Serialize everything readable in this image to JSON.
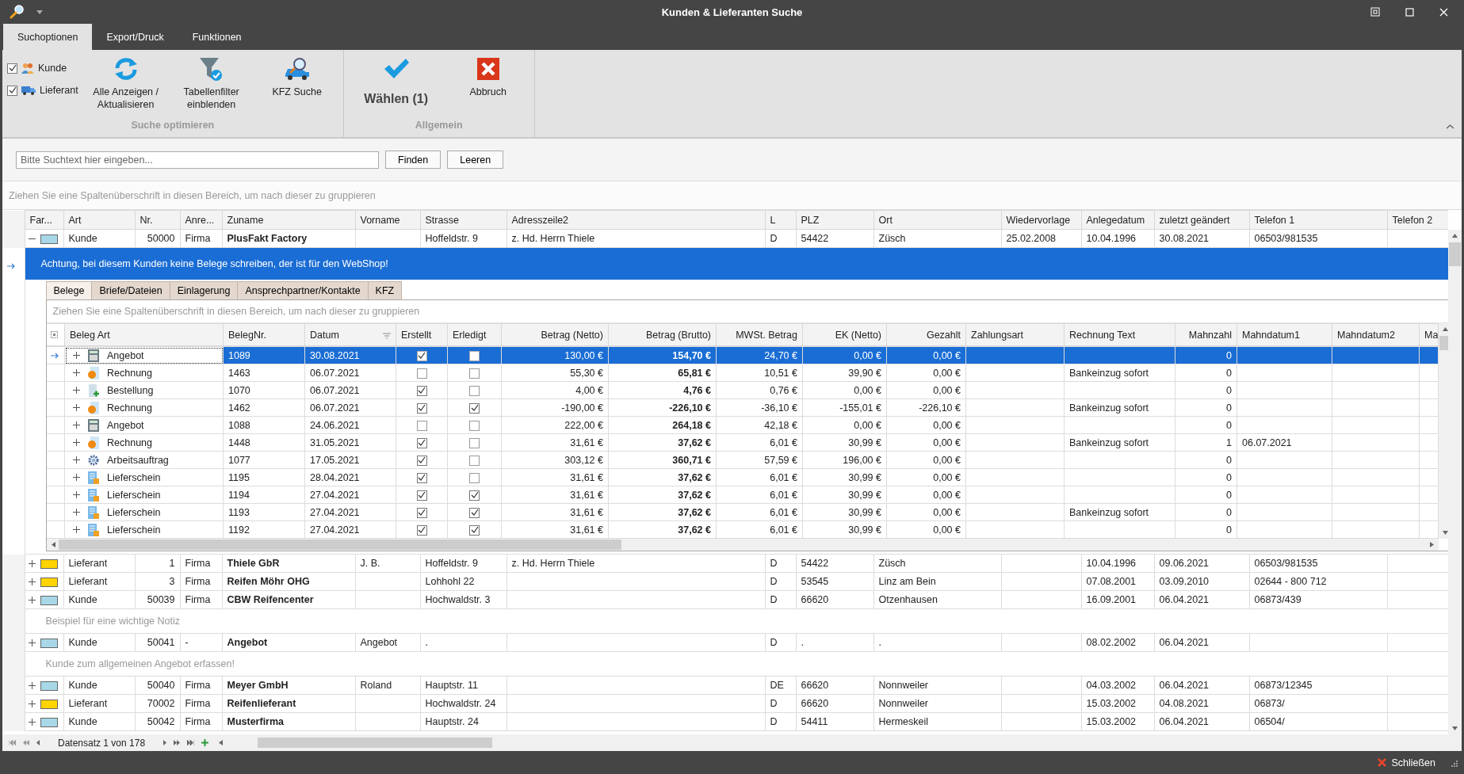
{
  "window": {
    "title": "Kunden & Lieferanten Suche"
  },
  "ribbon": {
    "tabs": [
      {
        "label": "Suchoptionen",
        "selected": true
      },
      {
        "label": "Export/Druck",
        "selected": false
      },
      {
        "label": "Funktionen",
        "selected": false
      }
    ],
    "groups": [
      {
        "label": "Suche optimieren",
        "checks": [
          {
            "label": "Kunde",
            "checked": true
          },
          {
            "label": "Lieferant",
            "checked": true
          }
        ],
        "buttons": [
          {
            "label": "Alle Anzeigen / Aktualisieren",
            "kind": "normal"
          },
          {
            "label": "Tabellenfilter einblenden",
            "kind": "normal"
          },
          {
            "label": "KFZ Suche",
            "kind": "normal"
          }
        ]
      },
      {
        "label": "Allgemein",
        "buttons": [
          {
            "label": "Wählen (1)",
            "kind": "primary"
          },
          {
            "label": "Abbruch",
            "kind": "normal"
          }
        ]
      }
    ]
  },
  "search": {
    "placeholder": "Bitte Suchtext hier eingeben...",
    "buttons": [
      "Finden",
      "Leeren"
    ]
  },
  "group_hint": "Ziehen Sie eine Spaltenüberschrift in diesen Bereich, um nach dieser zu gruppieren",
  "grid": {
    "columns": [
      "Far...",
      "Art",
      "Nr.",
      "Anre...",
      "Zuname",
      "Vorname",
      "Strasse",
      "Adresszeile2",
      "L",
      "PLZ",
      "Ort",
      "Wiedervorlage",
      "Anlegedatum",
      "zuletzt geändert",
      "Telefon 1",
      "Telefon 2"
    ],
    "rows": [
      {
        "expanded": true,
        "color": "#a8d8e8",
        "cells": [
          "",
          "Kunde",
          "50000",
          "Firma",
          "PlusFakt Factory",
          "",
          "Hoffeldstr. 9",
          "z. Hd. Herrn Thiele",
          "D",
          "54422",
          "Züsch",
          "25.02.2008",
          "10.04.1996",
          "30.08.2021",
          "06503/981535",
          ""
        ],
        "detail": {
          "banner": "Achtung, bei diesem Kunden keine Belege schreiben, der ist für den WebShop!",
          "tabs": [
            {
              "label": "Belege",
              "selected": true
            },
            {
              "label": "Briefe/Dateien",
              "selected": false
            },
            {
              "label": "Einlagerung",
              "selected": false
            },
            {
              "label": "Ansprechpartner/Kontakte",
              "selected": false
            },
            {
              "label": "KFZ",
              "selected": false
            }
          ],
          "group_hint": "Ziehen Sie eine Spaltenüberschrift in diesen Bereich, um nach dieser zu gruppieren",
          "columns": [
            {
              "label": "Beleg Art",
              "sorted": false
            },
            {
              "label": "BelegNr.",
              "sorted": false
            },
            {
              "label": "Datum",
              "sorted": true
            },
            {
              "label": "Erstellt",
              "sorted": false
            },
            {
              "label": "Erledigt",
              "sorted": false
            },
            {
              "label": "Betrag (Netto)",
              "sorted": false
            },
            {
              "label": "Betrag (Brutto)",
              "sorted": false
            },
            {
              "label": "MWSt. Betrag",
              "sorted": false
            },
            {
              "label": "EK (Netto)",
              "sorted": false
            },
            {
              "label": "Gezahlt",
              "sorted": false
            },
            {
              "label": "Zahlungsart",
              "sorted": false
            },
            {
              "label": "Rechnung Text",
              "sorted": false
            },
            {
              "label": "Mahnzahl",
              "sorted": false
            },
            {
              "label": "Mahndatum1",
              "sorted": false
            },
            {
              "label": "Mahndatum2",
              "sorted": false
            },
            {
              "label": "Ma",
              "sorted": false
            }
          ],
          "rows": [
            {
              "kind": "offer",
              "selected": true,
              "created": true,
              "done": false,
              "cells": [
                "Angebot",
                "1089",
                "30.08.2021",
                "",
                "",
                "130,00 €",
                "154,70 €",
                "24,70 €",
                "0,00 €",
                "0,00 €",
                "",
                "",
                "0",
                "",
                ""
              ]
            },
            {
              "kind": "invoice",
              "selected": false,
              "created": false,
              "done": false,
              "cells": [
                "Rechnung",
                "1463",
                "06.07.2021",
                "",
                "",
                "55,30 €",
                "65,81 €",
                "10,51 €",
                "39,90 €",
                "0,00 €",
                "",
                "Bankeinzug sofort",
                "0",
                "",
                ""
              ]
            },
            {
              "kind": "order",
              "selected": false,
              "created": true,
              "done": false,
              "cells": [
                "Bestellung",
                "1070",
                "06.07.2021",
                "",
                "",
                "4,00 €",
                "4,76 €",
                "0,76 €",
                "0,00 €",
                "0,00 €",
                "",
                "",
                "0",
                "",
                ""
              ]
            },
            {
              "kind": "invoice",
              "selected": false,
              "created": true,
              "done": true,
              "cells": [
                "Rechnung",
                "1462",
                "06.07.2021",
                "",
                "",
                "-190,00 €",
                "-226,10 €",
                "-36,10 €",
                "-155,01 €",
                "-226,10 €",
                "",
                "Bankeinzug sofort",
                "0",
                "",
                ""
              ]
            },
            {
              "kind": "offer",
              "selected": false,
              "created": false,
              "done": false,
              "cells": [
                "Angebot",
                "1088",
                "24.06.2021",
                "",
                "",
                "222,00 €",
                "264,18 €",
                "42,18 €",
                "0,00 €",
                "0,00 €",
                "",
                "",
                "0",
                "",
                ""
              ]
            },
            {
              "kind": "invoice",
              "selected": false,
              "created": true,
              "done": false,
              "cells": [
                "Rechnung",
                "1448",
                "31.05.2021",
                "",
                "",
                "31,61 €",
                "37,62 €",
                "6,01 €",
                "30,99 €",
                "0,00 €",
                "",
                "Bankeinzug sofort",
                "1",
                "06.07.2021",
                ""
              ]
            },
            {
              "kind": "job",
              "selected": false,
              "created": true,
              "done": false,
              "cells": [
                "Arbeitsauftrag",
                "1077",
                "17.05.2021",
                "",
                "",
                "303,12 €",
                "360,71 €",
                "57,59 €",
                "196,00 €",
                "0,00 €",
                "",
                "",
                "0",
                "",
                ""
              ]
            },
            {
              "kind": "delivery",
              "selected": false,
              "created": true,
              "done": false,
              "cells": [
                "Lieferschein",
                "1195",
                "28.04.2021",
                "",
                "",
                "31,61 €",
                "37,62 €",
                "6,01 €",
                "30,99 €",
                "0,00 €",
                "",
                "",
                "0",
                "",
                ""
              ]
            },
            {
              "kind": "delivery",
              "selected": false,
              "created": true,
              "done": true,
              "cells": [
                "Lieferschein",
                "1194",
                "27.04.2021",
                "",
                "",
                "31,61 €",
                "37,62 €",
                "6,01 €",
                "30,99 €",
                "0,00 €",
                "",
                "",
                "0",
                "",
                ""
              ]
            },
            {
              "kind": "delivery",
              "selected": false,
              "created": true,
              "done": true,
              "cells": [
                "Lieferschein",
                "1193",
                "27.04.2021",
                "",
                "",
                "31,61 €",
                "37,62 €",
                "6,01 €",
                "30,99 €",
                "0,00 €",
                "",
                "Bankeinzug sofort",
                "0",
                "",
                ""
              ]
            },
            {
              "kind": "delivery",
              "selected": false,
              "created": true,
              "done": true,
              "cells": [
                "Lieferschein",
                "1192",
                "27.04.2021",
                "",
                "",
                "31,61 €",
                "37,62 €",
                "6,01 €",
                "30,99 €",
                "0,00 €",
                "",
                "",
                "0",
                "",
                ""
              ]
            }
          ]
        }
      },
      {
        "expanded": false,
        "color": "#ffd400",
        "cells": [
          "",
          "Lieferant",
          "1",
          "Firma",
          "Thiele GbR",
          "J. B.",
          "Hoffeldstr. 9",
          "z. Hd. Herrn Thiele",
          "D",
          "54422",
          "Züsch",
          "",
          "10.04.1996",
          "09.06.2021",
          "06503/981535",
          ""
        ]
      },
      {
        "expanded": false,
        "color": "#ffd400",
        "cells": [
          "",
          "Lieferant",
          "3",
          "Firma",
          "Reifen Möhr OHG",
          "",
          "Lohhohl 22",
          "",
          "D",
          "53545",
          "Linz am Bein",
          "",
          "07.08.2001",
          "03.09.2010",
          "02644 - 800 712",
          ""
        ]
      },
      {
        "expanded": false,
        "color": "#a8d8e8",
        "cells": [
          "",
          "Kunde",
          "50039",
          "Firma",
          "CBW Reifencenter",
          "",
          "Hochwaldstr. 3",
          "",
          "D",
          "66620",
          "Otzenhausen",
          "",
          "16.09.2001",
          "06.04.2021",
          "06873/439",
          ""
        ],
        "note": "Beispiel für eine wichtige Notiz"
      },
      {
        "expanded": false,
        "color": "#a8d8e8",
        "cells": [
          "",
          "Kunde",
          "50041",
          "-",
          "Angebot",
          "Angebot",
          ".",
          "",
          "D",
          ".",
          ".",
          "",
          "08.02.2002",
          "06.04.2021",
          "",
          ""
        ],
        "note": "Kunde zum allgemeinen Angebot erfassen!"
      },
      {
        "expanded": false,
        "color": "#a8d8e8",
        "cells": [
          "",
          "Kunde",
          "50040",
          "Firma",
          "Meyer GmbH",
          "Roland",
          "Hauptstr. 11",
          "",
          "DE",
          "66620",
          "Nonnweiler",
          "",
          "04.03.2002",
          "06.04.2021",
          "06873/12345",
          ""
        ]
      },
      {
        "expanded": false,
        "color": "#ffd400",
        "cells": [
          "",
          "Lieferant",
          "70002",
          "Firma",
          "Reifenlieferant",
          "",
          "Hochwaldstr. 24",
          "",
          "D",
          "66620",
          "Nonnweiler",
          "",
          "15.03.2002",
          "04.08.2021",
          "06873/",
          ""
        ]
      },
      {
        "expanded": false,
        "color": "#a8d8e8",
        "cells": [
          "",
          "Kunde",
          "50042",
          "Firma",
          "Musterfirma",
          "",
          "Hauptstr. 24",
          "",
          "D",
          "54411",
          "Hermeskeil",
          "",
          "15.03.2002",
          "06.04.2021",
          "06504/",
          ""
        ]
      }
    ]
  },
  "navigator": {
    "text": "Datensatz 1 von 178"
  },
  "footer": {
    "close": "Schließen"
  }
}
